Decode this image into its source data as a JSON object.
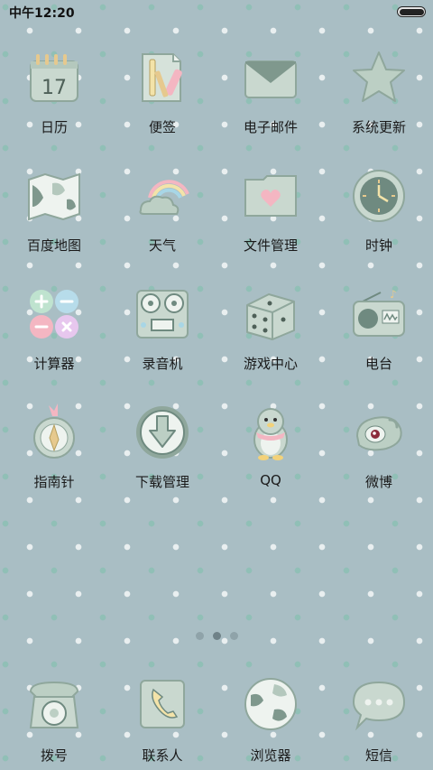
{
  "status_bar": {
    "time": "中午12:20"
  },
  "pages": {
    "count": 3,
    "active": 1
  },
  "apps": [
    {
      "label": "日历",
      "icon": "calendar-icon",
      "day": "17"
    },
    {
      "label": "便签",
      "icon": "notes-icon"
    },
    {
      "label": "电子邮件",
      "icon": "mail-icon"
    },
    {
      "label": "系统更新",
      "icon": "star-icon"
    },
    {
      "label": "百度地图",
      "icon": "map-icon"
    },
    {
      "label": "天气",
      "icon": "weather-icon"
    },
    {
      "label": "文件管理",
      "icon": "folder-icon"
    },
    {
      "label": "时钟",
      "icon": "clock-icon"
    },
    {
      "label": "计算器",
      "icon": "calculator-icon"
    },
    {
      "label": "录音机",
      "icon": "recorder-icon"
    },
    {
      "label": "游戏中心",
      "icon": "dice-icon"
    },
    {
      "label": "电台",
      "icon": "radio-icon"
    },
    {
      "label": "指南针",
      "icon": "compass-icon"
    },
    {
      "label": "下载管理",
      "icon": "download-icon"
    },
    {
      "label": "QQ",
      "icon": "penguin-icon"
    },
    {
      "label": "微博",
      "icon": "weibo-icon"
    }
  ],
  "dock": [
    {
      "label": "拨号",
      "icon": "phone-icon"
    },
    {
      "label": "联系人",
      "icon": "contacts-icon"
    },
    {
      "label": "浏览器",
      "icon": "browser-icon"
    },
    {
      "label": "短信",
      "icon": "message-icon"
    }
  ],
  "colors": {
    "background": "#a9bec4",
    "icon_base": "#c9d8cf",
    "accent_pink": "#f4b6c2"
  }
}
